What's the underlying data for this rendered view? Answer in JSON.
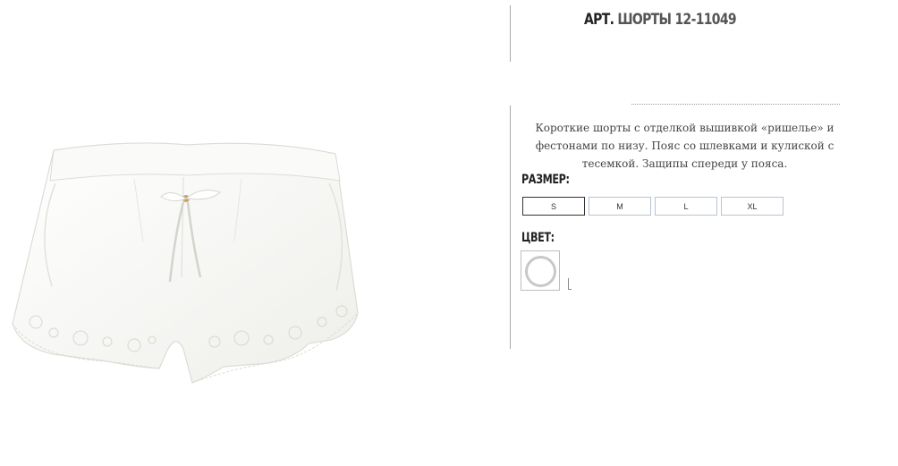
{
  "product": {
    "title_prefix": "АРТ.",
    "title_name": "ШОРТЫ 12-11049",
    "description": "Короткие шорты с отделкой вышивкой «ришелье» и фестонами по низу. Пояс со шлевками и кулиской с тесемкой. Защипы спереди у пояса.",
    "image_alt": "white-shorts-photo"
  },
  "size_section": {
    "label": "РАЗМЕР:",
    "options": [
      "S",
      "M",
      "L",
      "XL"
    ],
    "selected": "S"
  },
  "color_section": {
    "label": "ЦВЕТ:",
    "swatch_color": "#ffffff"
  },
  "colors": {
    "text_dark": "#222222",
    "text_muted": "#555555",
    "size_border": "#b7c4d4",
    "size_selected_border": "#333333"
  }
}
